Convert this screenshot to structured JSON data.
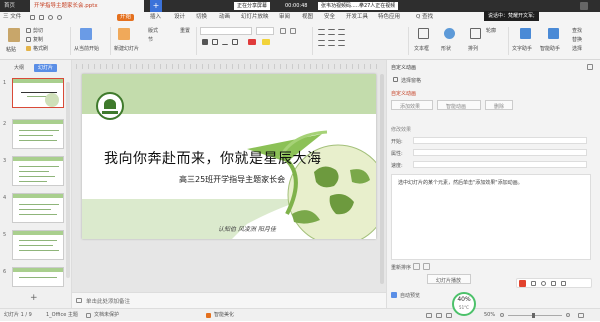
{
  "titlebar": {
    "home_tab": "首页",
    "doc_tab": "开学指导主题家长会.pptx",
    "plus": "+",
    "status_pill_1": "正在分享屏幕",
    "status_pill_2": "00:00:48",
    "status_pill_3": "张韦功视频码.....拳27人正在视频",
    "tooltip": "说话中：梵耀开文军;"
  },
  "menu": {
    "file": "三 文件",
    "start": "开始",
    "items": [
      "插入",
      "设计",
      "切换",
      "动画",
      "幻灯片放映",
      "审阅",
      "视图",
      "安全",
      "开发工具",
      "特色应用"
    ],
    "search": "Q 查找"
  },
  "ribbon": {
    "paste": "粘贴",
    "cut": "剪切",
    "copy": "复制",
    "format_painter": "格式刷",
    "from_current": "从当前开始",
    "new_slide": "新建幻灯片",
    "layout": "版式",
    "section": "节",
    "reset": "重置",
    "textbox": "文本框",
    "shape": "形状",
    "arrange": "排列",
    "outline": "轮廓",
    "text_assistant": "文字助手",
    "find": "查找",
    "replace": "替换",
    "select": "选择",
    "quick_style": "智能助手"
  },
  "leftpanel": {
    "tabs": [
      "大纲",
      "幻灯片"
    ],
    "slide_numbers": [
      "1",
      "2",
      "3",
      "4",
      "5",
      "6"
    ],
    "add": "+"
  },
  "slide": {
    "title": "我向你奔赴而来，你就是星辰大海",
    "subtitle": "高三25班开学指导主题家长会",
    "footer_text": "认知伯    风凌洲    阳月佳"
  },
  "notes": {
    "placeholder": "单击此处添加备注"
  },
  "rightpanel": {
    "header": "自定义动画",
    "select_pane": "选择窗格",
    "section": "自定义动画",
    "add_effect": "添加效果",
    "smart_animation": "智能动画",
    "remove": "删除",
    "modify_label": "修改效果",
    "start_label": "开始:",
    "property_label": "属性:",
    "speed_label": "速度:",
    "hint": "选中幻灯片的某个元素，然后单击\"添加效果\"添加动画。",
    "reorder": "重新排序",
    "play": "幻灯片播放",
    "autopreview": "自动预览"
  },
  "statusbar": {
    "slide_info": "幻灯片 1 / 9",
    "theme": "1_Office 主题",
    "file_status": "文档未保护",
    "beautify": "智能美化",
    "zoom": "50%",
    "cpu": "40%",
    "temp": "51°C"
  },
  "colors": {
    "accent": "#e4701e",
    "selected_tab": "#5a8ee6",
    "slide_green": "#a9cf8e"
  }
}
